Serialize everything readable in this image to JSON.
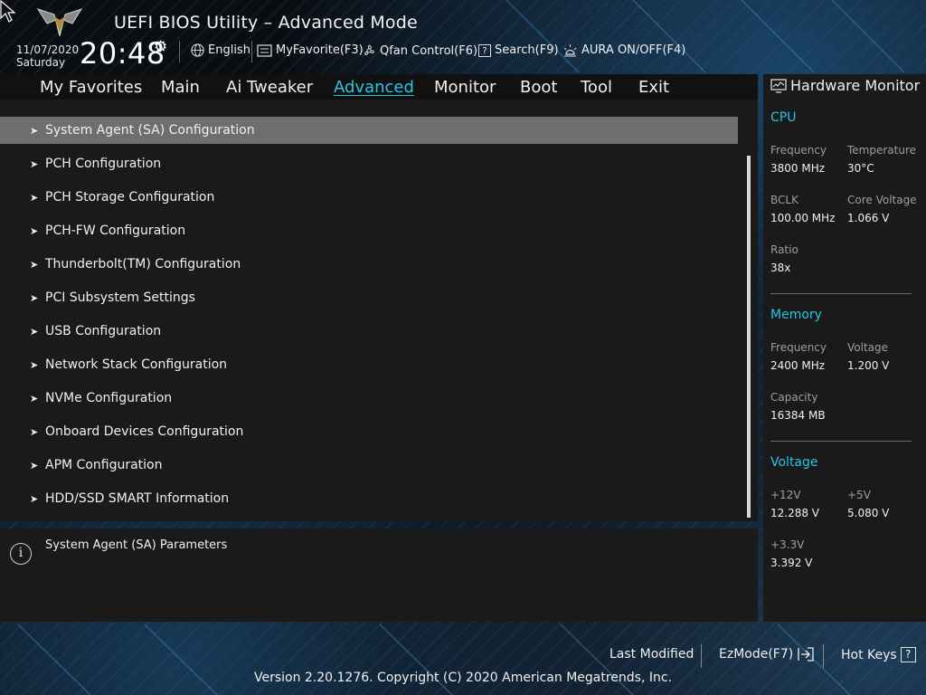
{
  "header": {
    "title": "UEFI BIOS Utility – Advanced Mode",
    "date": "11/07/2020",
    "day": "Saturday",
    "time": "20:48",
    "language": "English",
    "my_favorite": "MyFavorite(F3)",
    "qfan": "Qfan Control(F6)",
    "search": "Search(F9)",
    "aura": "AURA ON/OFF(F4)"
  },
  "tabs": [
    {
      "label": "My Favorites"
    },
    {
      "label": "Main"
    },
    {
      "label": "Ai Tweaker"
    },
    {
      "label": "Advanced",
      "active": true
    },
    {
      "label": "Monitor"
    },
    {
      "label": "Boot"
    },
    {
      "label": "Tool"
    },
    {
      "label": "Exit"
    }
  ],
  "menu_items": [
    {
      "label": "System Agent (SA) Configuration",
      "selected": true
    },
    {
      "label": "PCH Configuration"
    },
    {
      "label": "PCH Storage Configuration"
    },
    {
      "label": "PCH-FW Configuration"
    },
    {
      "label": "Thunderbolt(TM) Configuration"
    },
    {
      "label": "PCI Subsystem Settings"
    },
    {
      "label": "USB Configuration"
    },
    {
      "label": "Network Stack Configuration"
    },
    {
      "label": "NVMe Configuration"
    },
    {
      "label": "Onboard Devices Configuration"
    },
    {
      "label": "APM Configuration"
    },
    {
      "label": "HDD/SSD SMART Information"
    }
  ],
  "help": {
    "text": "System Agent (SA) Parameters"
  },
  "hardware_monitor": {
    "title": "Hardware Monitor",
    "cpu": {
      "heading": "CPU",
      "frequency_label": "Frequency",
      "frequency": "3800 MHz",
      "temperature_label": "Temperature",
      "temperature": "30°C",
      "bclk_label": "BCLK",
      "bclk": "100.00 MHz",
      "core_voltage_label": "Core Voltage",
      "core_voltage": "1.066 V",
      "ratio_label": "Ratio",
      "ratio": "38x"
    },
    "memory": {
      "heading": "Memory",
      "frequency_label": "Frequency",
      "frequency": "2400 MHz",
      "voltage_label": "Voltage",
      "voltage": "1.200 V",
      "capacity_label": "Capacity",
      "capacity": "16384 MB"
    },
    "voltage": {
      "heading": "Voltage",
      "v12_label": "+12V",
      "v12": "12.288 V",
      "v5_label": "+5V",
      "v5": "5.080 V",
      "v33_label": "+3.3V",
      "v33": "3.392 V"
    }
  },
  "footer": {
    "last_modified": "Last Modified",
    "ezmode": "EzMode(F7)",
    "hotkeys": "Hot Keys",
    "hotkeys_key": "?",
    "copyright": "Version 2.20.1276. Copyright (C) 2020 American Megatrends, Inc."
  },
  "colors": {
    "accent": "#27c6e8",
    "panel": "#1a1a1a",
    "selected_row": "#6e6e6e"
  }
}
